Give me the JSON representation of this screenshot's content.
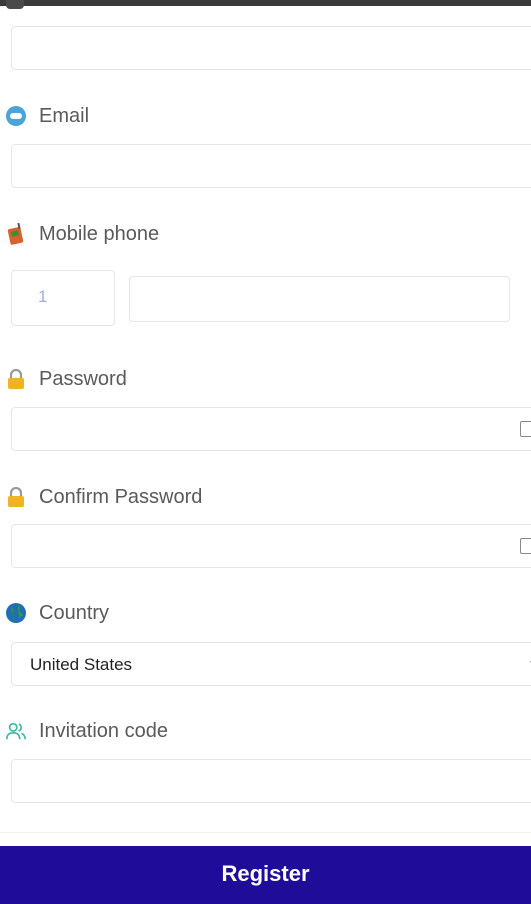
{
  "form": {
    "email": {
      "label": "Email",
      "icon": "email-icon",
      "value": ""
    },
    "mobile": {
      "label": "Mobile phone",
      "icon": "mobile-phone-icon",
      "country_code": "1",
      "number": ""
    },
    "password": {
      "label": "Password",
      "icon": "lock-icon",
      "value": ""
    },
    "confirm_password": {
      "label": "Confirm Password",
      "icon": "lock-icon",
      "value": ""
    },
    "country": {
      "label": "Country",
      "icon": "globe-icon",
      "selected": "United States"
    },
    "invitation": {
      "label": "Invitation code",
      "icon": "users-icon",
      "value": ""
    },
    "register_label": "Register"
  },
  "colors": {
    "button_bg": "#1f0d9a",
    "border": "#e6e6e6",
    "label_text": "#5a5a5a",
    "country_code_text": "#9fb0d8"
  }
}
